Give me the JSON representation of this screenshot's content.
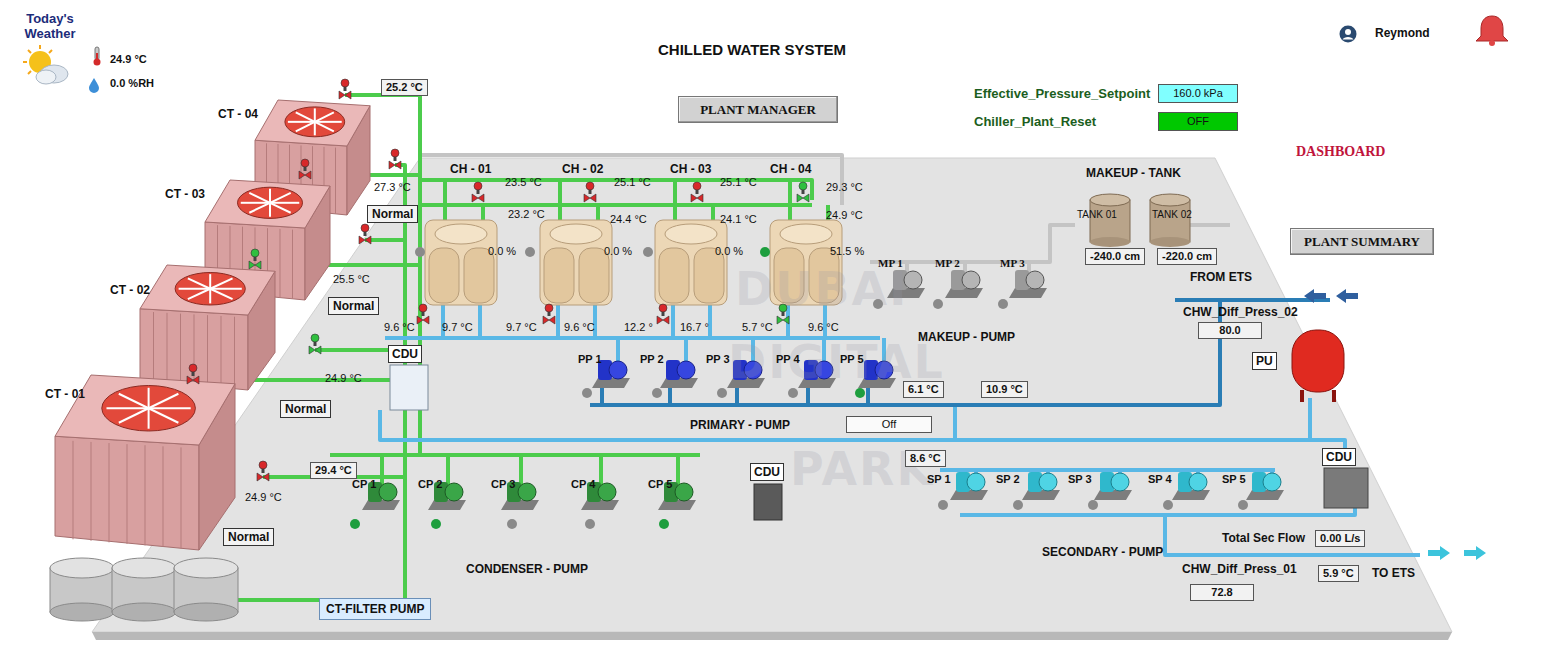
{
  "weather": {
    "title": "Today's Weather",
    "temperature": "24.9 °C",
    "humidity": "0.0 %RH"
  },
  "title": "CHILLED WATER SYSTEM",
  "user": "Reymond",
  "buttons": {
    "plant_manager": "PLANT MANAGER",
    "dashboard": "DASHBOARD",
    "plant_summary": "PLANT SUMMARY",
    "ct_filter_pump": "CT-FILTER PUMP"
  },
  "setpoints": [
    {
      "label": "Effective_Pressure_Setpoint",
      "value": "160.0 kPa",
      "color": "#80ffff"
    },
    {
      "label": "Chiller_Plant_Reset",
      "value": "OFF",
      "color": "#00c800"
    }
  ],
  "cooling_towers": [
    {
      "name": "CT - 04",
      "temperature": "27.3 °C",
      "status": "Normal"
    },
    {
      "name": "CT - 03",
      "temperature": "25.5 °C",
      "status": "Normal"
    },
    {
      "name": "CT - 02",
      "temperature": "24.9 °C",
      "status": "Normal"
    },
    {
      "name": "CT - 01",
      "temperature": "24.9 °C",
      "status": "Normal"
    }
  ],
  "condenser_headers": [
    "25.2 °C",
    "29.4 °C"
  ],
  "chillers": [
    {
      "name": "CH - 01",
      "temp_top": "23.5 °C",
      "temp_mid": "23.2 °C",
      "load": "0.0 %",
      "running": false,
      "temp_left": "9.6 °C",
      "temp_right": "9.7 °C"
    },
    {
      "name": "CH - 02",
      "temp_top": "25.1 °C",
      "temp_mid": "24.4 °C",
      "load": "0.0 %",
      "running": false,
      "temp_left": "9.7 °C",
      "temp_right": "9.6 °C"
    },
    {
      "name": "CH - 03",
      "temp_top": "25.1 °C",
      "temp_mid": "24.1 °C",
      "load": "0.0 %",
      "running": false,
      "temp_left": "12.2 °",
      "temp_right": "16.7 °"
    },
    {
      "name": "CH - 04",
      "temp_top": "29.3 °C",
      "temp_mid": "24.9 °C",
      "load": "51.5 %",
      "running": true,
      "temp_left": "5.7 °C",
      "temp_right": "9.6 °C"
    }
  ],
  "primary": {
    "title": "PRIMARY - PUMP",
    "supply": "6.1 °C",
    "return": "10.9 °C",
    "mode": "Off",
    "pumps": [
      {
        "name": "PP 1",
        "running": false
      },
      {
        "name": "PP 2",
        "running": false
      },
      {
        "name": "PP 3",
        "running": false
      },
      {
        "name": "PP 4",
        "running": false
      },
      {
        "name": "PP 5",
        "running": true
      }
    ]
  },
  "condenser": {
    "title": "CONDENSER - PUMP",
    "pumps": [
      {
        "name": "CP 1",
        "running": true
      },
      {
        "name": "CP 2",
        "running": true
      },
      {
        "name": "CP 3",
        "running": false
      },
      {
        "name": "CP 4",
        "running": false
      },
      {
        "name": "CP 5",
        "running": true
      }
    ]
  },
  "secondary": {
    "title": "SECONDARY - PUMP",
    "temperature": "8.6 °C",
    "flow_label": "Total Sec Flow",
    "flow": "0.00 L/s",
    "pumps": [
      {
        "name": "SP 1",
        "running": false
      },
      {
        "name": "SP 2",
        "running": false
      },
      {
        "name": "SP 3",
        "running": false
      },
      {
        "name": "SP 4",
        "running": false
      },
      {
        "name": "SP 5",
        "running": false
      }
    ]
  },
  "makeup": {
    "tank_title": "MAKEUP - TANK",
    "pump_title": "MAKEUP - PUMP",
    "tanks": [
      {
        "name": "TANK 01",
        "level": "-240.0 cm"
      },
      {
        "name": "TANK 02",
        "level": "-220.0 cm"
      }
    ],
    "pumps": [
      {
        "name": "MP 1",
        "running": false
      },
      {
        "name": "MP 2",
        "running": false
      },
      {
        "name": "MP 3",
        "running": false
      }
    ]
  },
  "ets": {
    "from": "FROM ETS",
    "to": "TO ETS",
    "supply_temperature": "5.9 °C",
    "diff_press": [
      {
        "label": "CHW_Diff_Press_02",
        "value": "80.0"
      },
      {
        "label": "CHW_Diff_Press_01",
        "value": "72.8"
      }
    ]
  },
  "pressurisation_unit": "PU",
  "cdus": [
    "CDU",
    "CDU",
    "CDU"
  ],
  "valves": [
    {
      "open": false
    },
    {
      "open": false
    },
    {
      "open": false
    },
    {
      "open": false
    },
    {
      "open": true
    },
    {
      "open": true
    },
    {
      "open": false
    },
    {
      "open": false
    },
    {
      "open": false
    },
    {
      "open": false
    },
    {
      "open": false
    },
    {
      "open": true
    },
    {
      "open": false
    },
    {
      "open": false
    },
    {
      "open": false
    },
    {
      "open": true
    }
  ],
  "watermark": [
    "DUBAI",
    "DIGITAL",
    "PARK"
  ]
}
